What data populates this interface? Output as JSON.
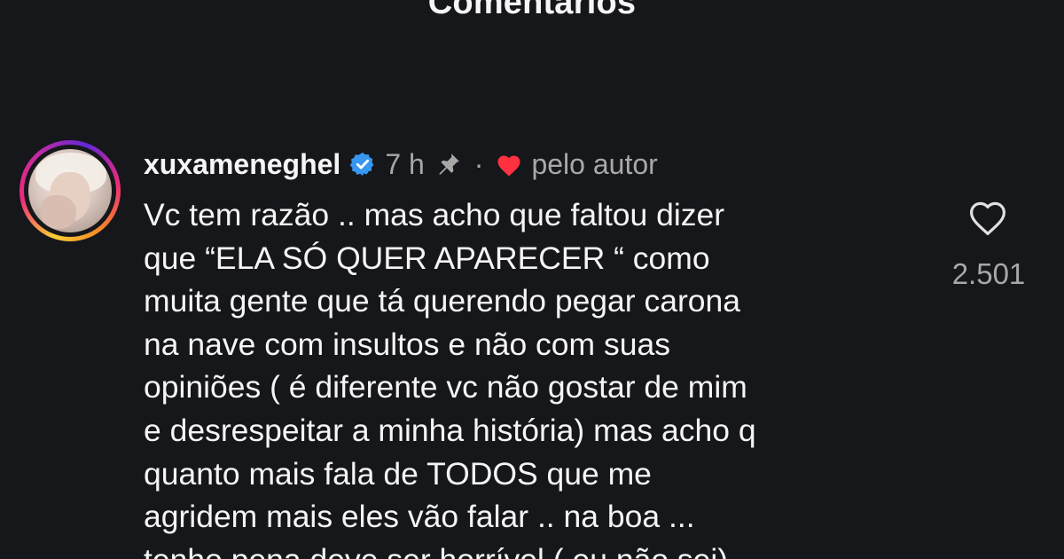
{
  "sheet": {
    "title": "Comentários"
  },
  "comment": {
    "username": "xuxameneghel",
    "verified": true,
    "time": "7 h",
    "separator": "·",
    "author_label": "pelo autor",
    "text_lines": [
      "Vc tem razão .. mas acho que faltou dizer",
      "que “ELA SÓ QUER APARECER “ como",
      "muita gente que tá querendo pegar carona",
      "na nave com insultos e não com suas",
      "opiniões ( é diferente vc não gostar de mim",
      "e desrespeitar a minha história) mas acho q",
      "quanto mais fala de TODOS que me",
      "agridem mais eles vão falar .. na boa ...",
      "tenho pena deve ser horrível ( eu não sei)"
    ],
    "likes": "2.501"
  },
  "icons": {
    "verified": "verified-badge-icon",
    "pin": "pin-icon",
    "author_heart": "heart-filled-icon",
    "like": "heart-outline-icon"
  },
  "colors": {
    "background": "#16171b",
    "text": "#f5f5f5",
    "secondary_text": "#a8a8a8",
    "verified_blue": "#3897f0",
    "heart_red": "#ff3040"
  }
}
